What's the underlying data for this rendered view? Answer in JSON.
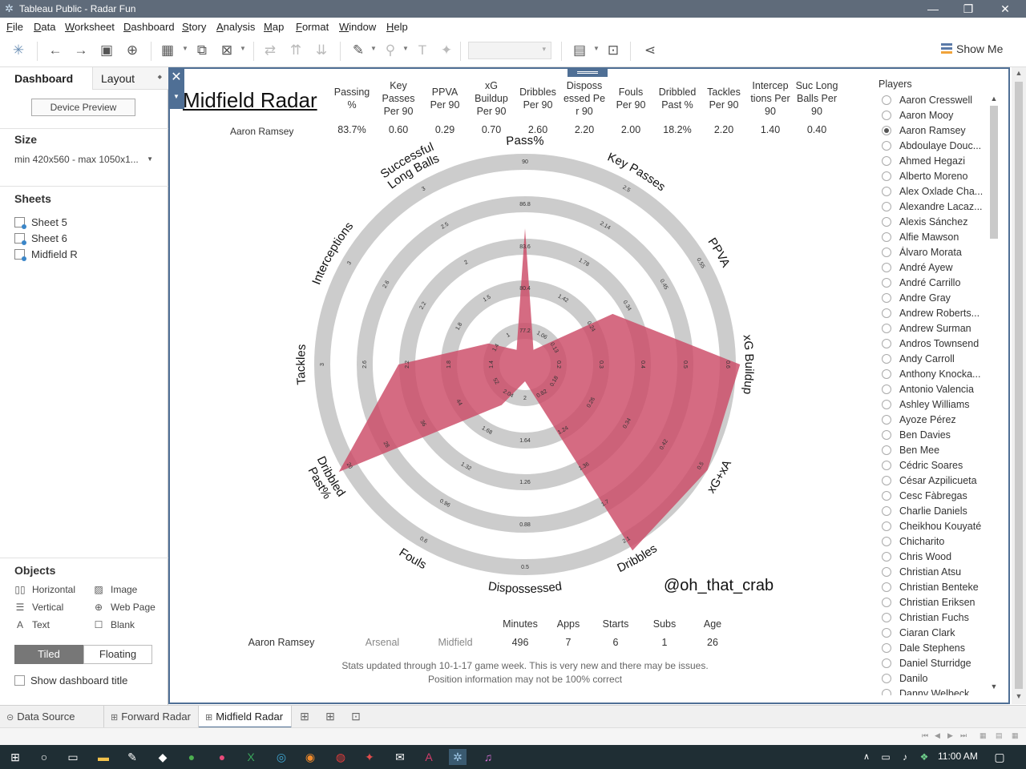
{
  "window": {
    "title": "Tableau Public - Radar Fun"
  },
  "menu": [
    "File",
    "Data",
    "Worksheet",
    "Dashboard",
    "Story",
    "Analysis",
    "Map",
    "Format",
    "Window",
    "Help"
  ],
  "toolbar": {
    "show_me": "Show Me"
  },
  "left_pane": {
    "tabs": {
      "dashboard": "Dashboard",
      "layout": "Layout"
    },
    "device_preview": "Device Preview",
    "size_heading": "Size",
    "size_value": "min 420x560 - max 1050x1...",
    "sheets_heading": "Sheets",
    "sheets": [
      "Sheet 5",
      "Sheet 6",
      "Midfield R"
    ],
    "objects_heading": "Objects",
    "objects": {
      "horizontal": "Horizontal",
      "image": "Image",
      "vertical": "Vertical",
      "web_page": "Web Page",
      "text": "Text",
      "blank": "Blank"
    },
    "tiled": "Tiled",
    "floating": "Floating",
    "show_title": "Show dashboard title"
  },
  "dashboard": {
    "title": "Midfield Radar",
    "player": "Aaron Ramsey",
    "stats": [
      {
        "l1": "Passing",
        "l2": "%",
        "l3": "",
        "value": "83.7%"
      },
      {
        "l1": "Key",
        "l2": "Passes",
        "l3": "Per 90",
        "value": "0.60"
      },
      {
        "l1": "PPVA",
        "l2": "Per 90",
        "l3": "",
        "value": "0.29"
      },
      {
        "l1": "xG",
        "l2": "Buildup",
        "l3": "Per 90",
        "value": "0.70"
      },
      {
        "l1": "Dribbles",
        "l2": "Per 90",
        "l3": "",
        "value": "2.60"
      },
      {
        "l1": "Disposs",
        "l2": "essed Pe",
        "l3": "r 90",
        "value": "2.20"
      },
      {
        "l1": "Fouls",
        "l2": "Per 90",
        "l3": "",
        "value": "2.00"
      },
      {
        "l1": "Dribbled",
        "l2": "Past %",
        "l3": "",
        "value": "18.2%"
      },
      {
        "l1": "Tackles",
        "l2": "Per 90",
        "l3": "",
        "value": "2.20"
      },
      {
        "l1": "Intercep",
        "l2": "tions Per",
        "l3": "90",
        "value": "1.40"
      },
      {
        "l1": "Suc Long",
        "l2": "Balls Per",
        "l3": "90",
        "value": "0.40"
      }
    ],
    "handle": "@oh_that_crab",
    "info_headers": [
      "Minutes",
      "Apps",
      "Starts",
      "Subs",
      "Age"
    ],
    "info": {
      "player": "Aaron Ramsey",
      "team": "Arsenal",
      "position": "Midfield",
      "minutes": "496",
      "apps": "7",
      "starts": "6",
      "subs": "1",
      "age": "26"
    },
    "note_1": "Stats updated through 10-1-17 game week. This is very new and there may be issues.",
    "note_2": "Position information may not be 100% correct"
  },
  "chart_data": {
    "type": "radar",
    "player": "Aaron Ramsey",
    "fill_color": "#cc4a66",
    "ring_color": "#cccccc",
    "axes": [
      {
        "label": "Pass%",
        "value": 83.7,
        "min": 72.2,
        "max": 90,
        "ticks": [
          "90",
          "86.8",
          "83.6",
          "80.4",
          "77.2"
        ]
      },
      {
        "label": "Key Passes",
        "value": 0.6,
        "min": 0.7,
        "max": 2.5,
        "ticks": [
          "2.5",
          "2.14",
          "1.78",
          "1.42",
          "1.06"
        ]
      },
      {
        "label": "PPVA",
        "value": 0.29,
        "min": 0.05,
        "max": 0.55,
        "ticks": [
          "0.55",
          "0.45",
          "0.34",
          "0.24",
          "0.13"
        ]
      },
      {
        "label": "xG Buildup",
        "value": 0.7,
        "min": 0.1,
        "max": 0.6,
        "ticks": [
          "0.6",
          "0.5",
          "0.4",
          "0.3",
          "0.2"
        ]
      },
      {
        "label": "xG+xA",
        "value": 0.5,
        "min": 0.1,
        "max": 0.5,
        "ticks": [
          "0.5",
          "0.42",
          "0.34",
          "0.26",
          "0.18"
        ]
      },
      {
        "label": "Dribbles",
        "value": 2.6,
        "min": 0.1,
        "max": 2.1,
        "ticks": [
          "2.1",
          "1.7",
          "1.36",
          "1.24",
          "0.82"
        ]
      },
      {
        "label": "Dispossessed",
        "value": 2.2,
        "min": 2.0,
        "max": 0.5,
        "ticks": [
          "0.5",
          "0.88",
          "1.26",
          "1.64",
          "2"
        ]
      },
      {
        "label": "Fouls",
        "value": 2.0,
        "min": 2.4,
        "max": 0.6,
        "ticks": [
          "0.6",
          "0.96",
          "1.32",
          "1.68",
          "2.04"
        ]
      },
      {
        "label": "Dribbled Past%",
        "value": 18.2,
        "min": 60,
        "max": 20,
        "ticks": [
          "20",
          "28",
          "36",
          "44",
          "52"
        ]
      },
      {
        "label": "Tackles",
        "value": 2.2,
        "min": 1.0,
        "max": 3,
        "ticks": [
          "3",
          "2.6",
          "2.2",
          "1.8",
          "1.4"
        ]
      },
      {
        "label": "Interceptions",
        "value": 1.4,
        "min": 1.0,
        "max": 3,
        "ticks": [
          "3",
          "2.6",
          "2.2",
          "1.8",
          "1.4"
        ]
      },
      {
        "label": "Successful Long Balls",
        "value": 0.4,
        "min": 0.5,
        "max": 3,
        "ticks": [
          "3",
          "2.5",
          "2",
          "1.5",
          "1"
        ]
      }
    ]
  },
  "players": {
    "title": "Players",
    "selected": "Aaron Ramsey",
    "items": [
      "Aaron Cresswell",
      "Aaron Mooy",
      "Aaron Ramsey",
      "Abdoulaye Douc...",
      "Ahmed Hegazi",
      "Alberto Moreno",
      "Alex Oxlade Cha...",
      "Alexandre Lacaz...",
      "Alexis Sánchez",
      "Alfie Mawson",
      "Álvaro Morata",
      "André Ayew",
      "André Carrillo",
      "Andre Gray",
      "Andrew Roberts...",
      "Andrew Surman",
      "Andros Townsend",
      "Andy Carroll",
      "Anthony Knocka...",
      "Antonio Valencia",
      "Ashley Williams",
      "Ayoze Pérez",
      "Ben Davies",
      "Ben Mee",
      "Cédric Soares",
      "César Azpilicueta",
      "Cesc Fàbregas",
      "Charlie Daniels",
      "Cheikhou Kouyaté",
      "Chicharito",
      "Chris Wood",
      "Christian Atsu",
      "Christian Benteke",
      "Christian Eriksen",
      "Christian Fuchs",
      "Ciaran Clark",
      "Dale Stephens",
      "Daniel Sturridge",
      "Danilo",
      "Danny Welbeck"
    ]
  },
  "tabs": {
    "data_source": "Data Source",
    "forward": "Forward Radar",
    "midfield": "Midfield Radar"
  },
  "clock": "11:00 AM"
}
